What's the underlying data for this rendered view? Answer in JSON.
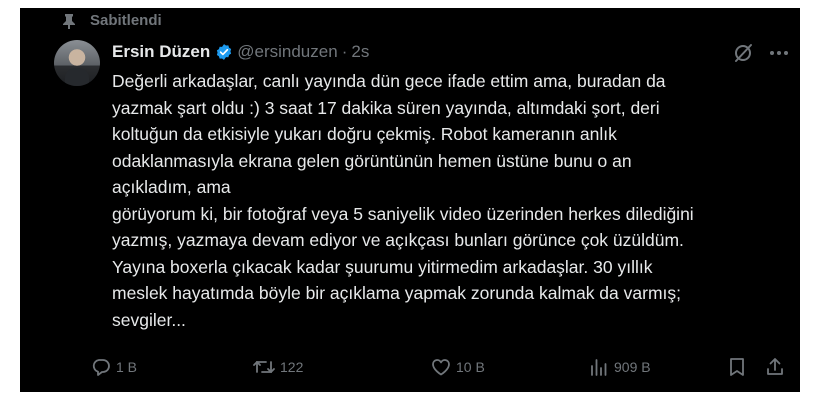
{
  "pinned": {
    "label": "Sabitlendi",
    "icon": "pin-icon"
  },
  "author": {
    "name": "Ersin Düzen",
    "handle": "@ersinduzen",
    "separator": "·",
    "time": "2s",
    "verified_color": "#1d9bf0"
  },
  "tweet": {
    "lines": [
      "Değerli arkadaşlar, canlı yayında dün gece ifade ettim ama, buradan da",
      "yazmak şart oldu :)  3 saat 17 dakika süren yayında, altımdaki şort, deri",
      "koltuğun da etkisiyle yukarı doğru çekmiş. Robot kameranın anlık",
      "odaklanmasıyla ekrana gelen görüntünün hemen üstüne bunu o an",
      "açıkladım, ama",
      "görüyorum ki, bir fotoğraf veya 5 saniyelik video üzerinden herkes dilediğini",
      "yazmış, yazmaya devam ediyor ve açıkçası bunları görünce çok üzüldüm.",
      "Yayına boxerla çıkacak kadar şuurumu yitirmedim arkadaşlar. 30 yıllık",
      "meslek hayatımda böyle bir açıklama yapmak zorunda kalmak da varmış;",
      "sevgiler..."
    ]
  },
  "actions": {
    "reply_count": "1 B",
    "retweet_count": "122",
    "like_count": "10 B",
    "views_count": "909 B"
  },
  "colors": {
    "background": "#000000",
    "text": "#e7e9ea",
    "muted": "#71767b",
    "accent": "#1d9bf0"
  }
}
